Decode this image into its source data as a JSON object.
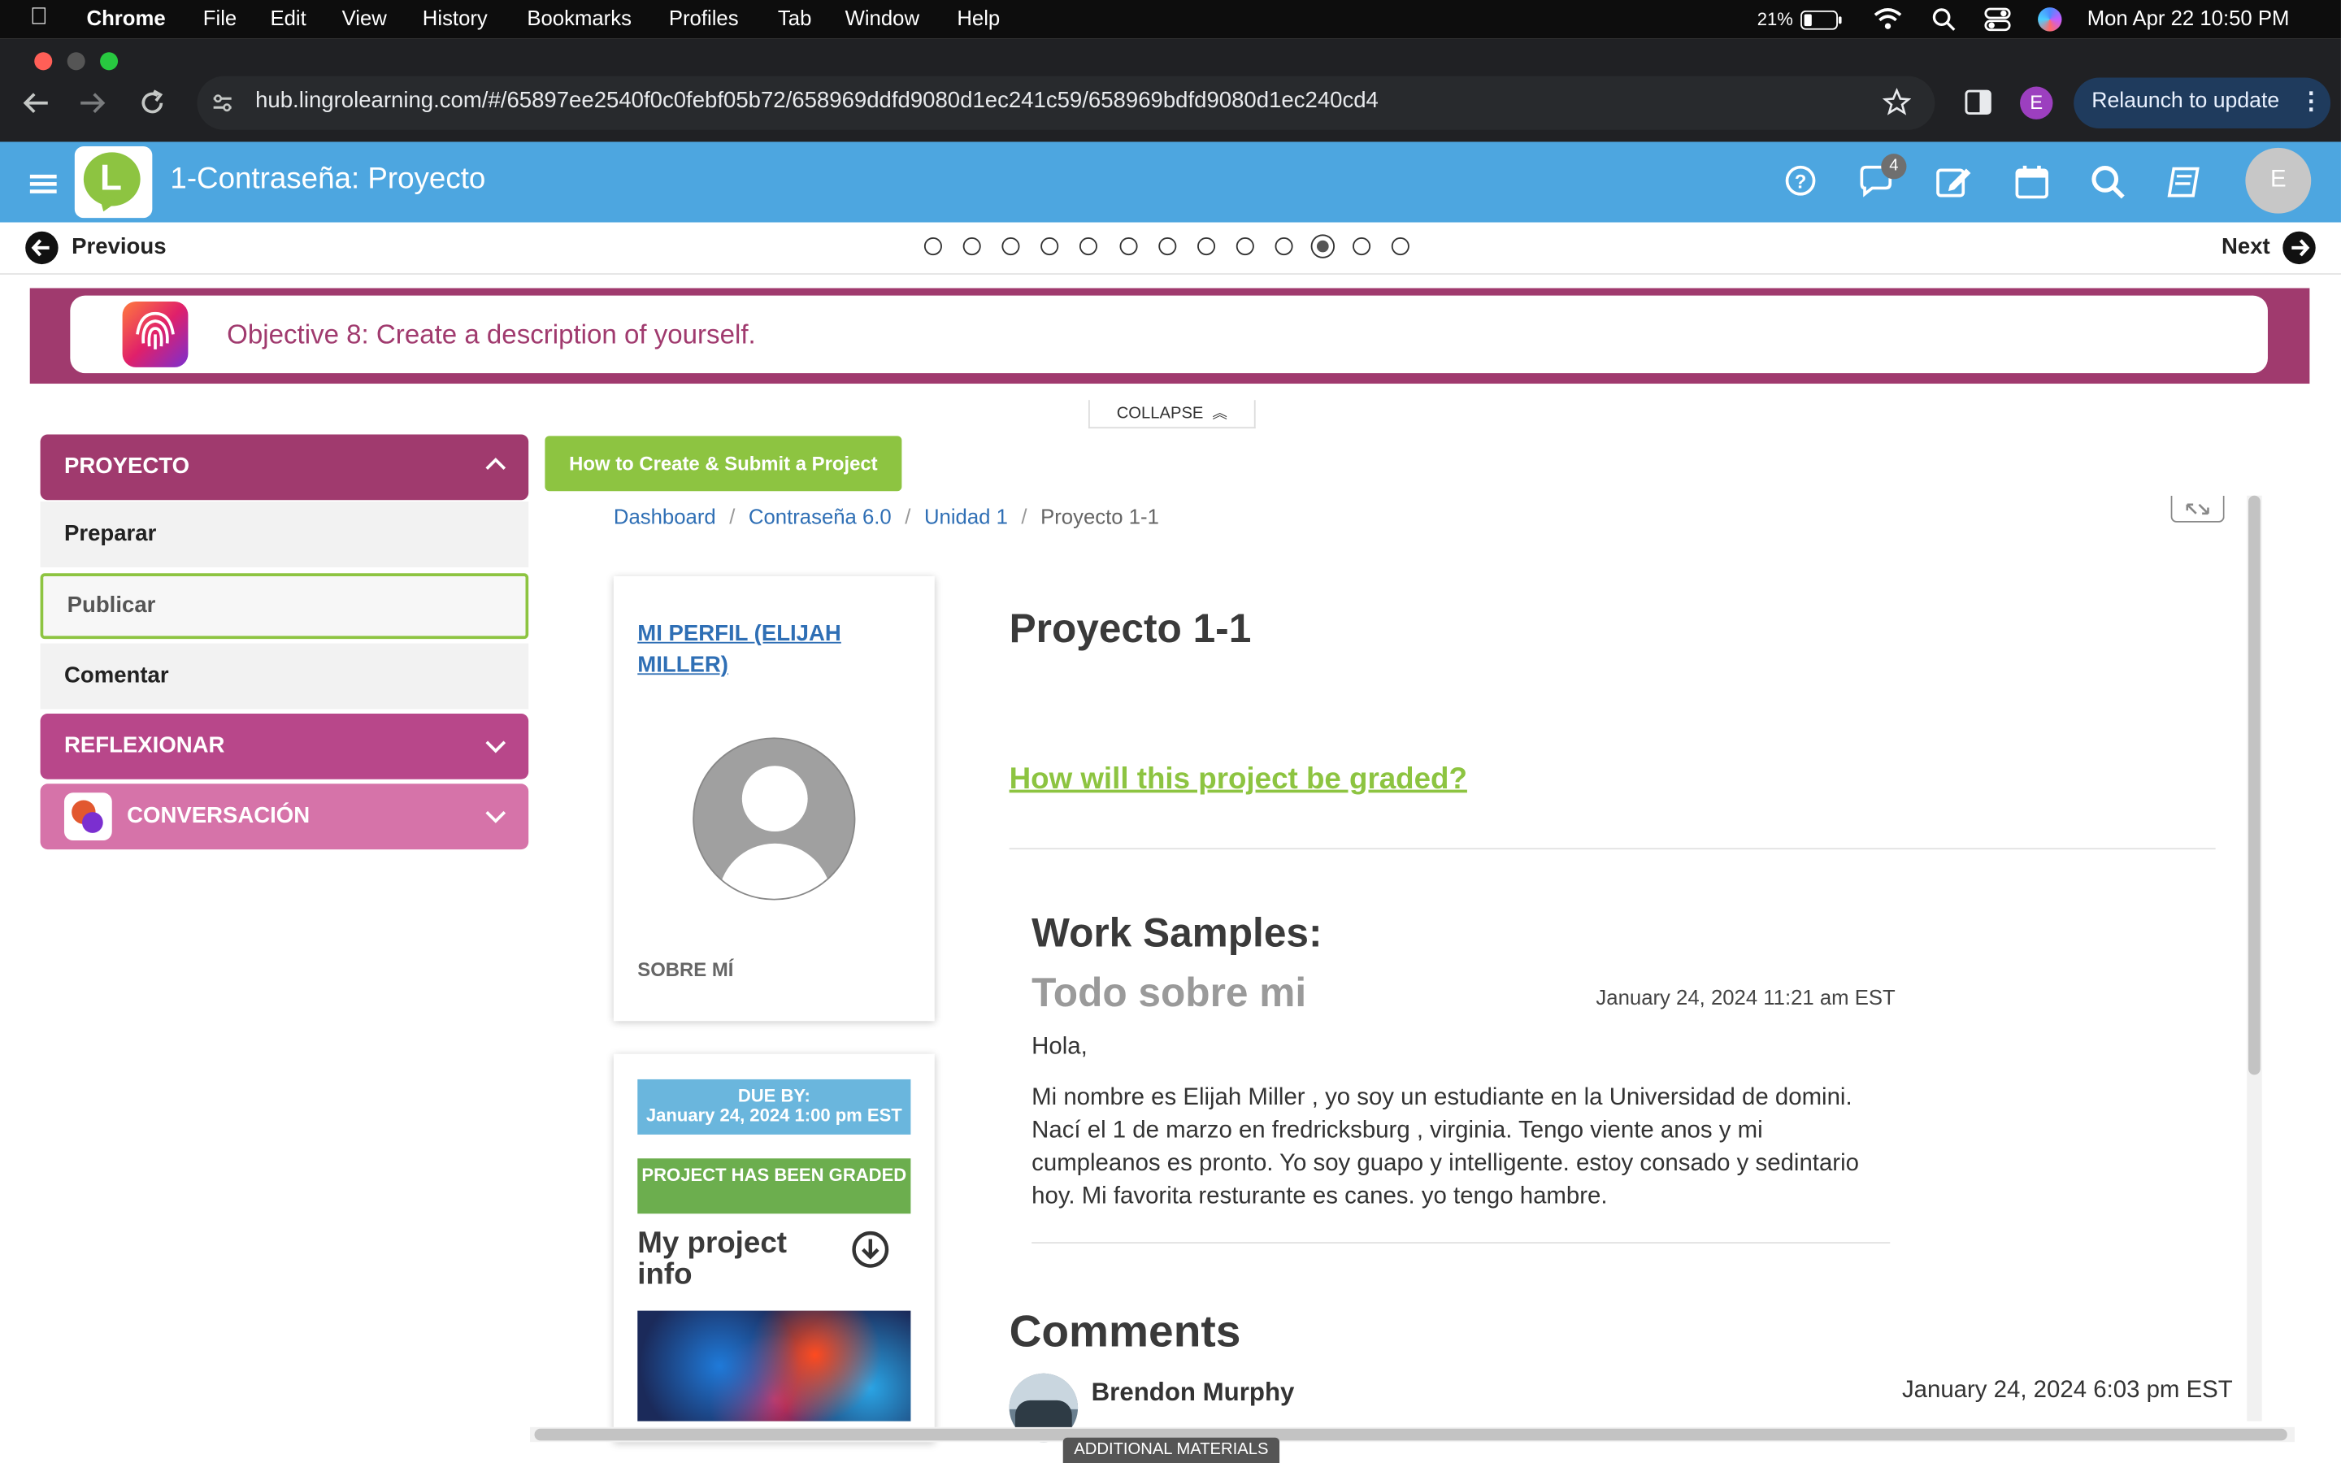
{
  "menubar": {
    "app": "Chrome",
    "items": [
      "File",
      "Edit",
      "View",
      "History",
      "Bookmarks",
      "Profiles",
      "Tab",
      "Window",
      "Help"
    ],
    "battery": "21%",
    "datetime": "Mon Apr 22  10:50 PM"
  },
  "browser": {
    "url": "hub.lingrolearning.com/#/65897ee2540f0c0febf05b72/658969ddfd9080d1ec241c59/658969bdfd9080d1ec240cd4",
    "profile_initial": "E",
    "relaunch_label": "Relaunch to update"
  },
  "header": {
    "title": "1-Contraseña: Proyecto",
    "logo_letter": "L",
    "chat_badge": "4",
    "avatar_initial": "E"
  },
  "nav": {
    "previous": "Previous",
    "next": "Next",
    "total_steps": 13,
    "current_step": 11
  },
  "objective": {
    "text": "Objective 8: Create a description of yourself.",
    "collapse_label": "COLLAPSE"
  },
  "sidebar": {
    "proyecto": "PROYECTO",
    "preparar": "Preparar",
    "publicar": "Publicar",
    "comentar": "Comentar",
    "reflexionar": "REFLEXIONAR",
    "conversacion": "CONVERSACIÓN"
  },
  "how_button": "How to Create & Submit a Project",
  "breadcrumb": {
    "items": [
      "Dashboard",
      "Contraseña 6.0",
      "Unidad 1"
    ],
    "current": "Proyecto 1-1"
  },
  "profile": {
    "link": "MI PERFIL (ELIJAH MILLER)",
    "about": "SOBRE MÍ"
  },
  "project_info": {
    "due_label": "DUE BY:",
    "due_date": "January 24, 2024 1:00 pm EST",
    "graded_label": "PROJECT HAS BEEN GRADED",
    "title": "My project info"
  },
  "main": {
    "title": "Proyecto 1-1",
    "graded_link": "How will this project be graded?",
    "work_samples_heading": "Work Samples:",
    "sample_title": "Todo sobre mi",
    "sample_date": "January 24, 2024 11:21 am EST",
    "sample_greeting": "Hola,",
    "sample_body": "Mi nombre es Elijah Miller , yo soy un estudiante en la Universidad de domini. Nací el 1 de marzo en fredricksburg , virginia. Tengo viente anos y mi cumpleanos es pronto. Yo soy guapo y intelligente. estoy consado y sedintario hoy. Mi favorita resturante es canes. yo tengo hambre.",
    "comments_heading": "Comments",
    "comment_author": "Brendon Murphy",
    "comment_date": "January 24, 2024 6:03 pm EST"
  },
  "additional_materials": "ADDITIONAL MATERIALS",
  "colors": {
    "header_blue": "#4da6e0",
    "magenta": "#a03a6e",
    "section_pink": "#b8478a",
    "section_light_pink": "#d673a9",
    "green": "#8dc441",
    "link_blue": "#2f6fb5"
  },
  "icons": [
    "apple-icon",
    "battery-icon",
    "wifi-icon",
    "search-icon",
    "control-center-icon",
    "siri-icon",
    "back-icon",
    "forward-icon",
    "reload-icon",
    "site-settings-icon",
    "bookmark-star-icon",
    "side-panel-icon",
    "menu-icon",
    "help-icon",
    "chat-icon",
    "edit-icon",
    "calendar-icon",
    "search-icon",
    "book-icon",
    "arrow-left-icon",
    "arrow-right-icon",
    "fingerprint-icon",
    "chevron-up-icon",
    "chevron-down-icon",
    "download-icon",
    "expand-icon"
  ]
}
